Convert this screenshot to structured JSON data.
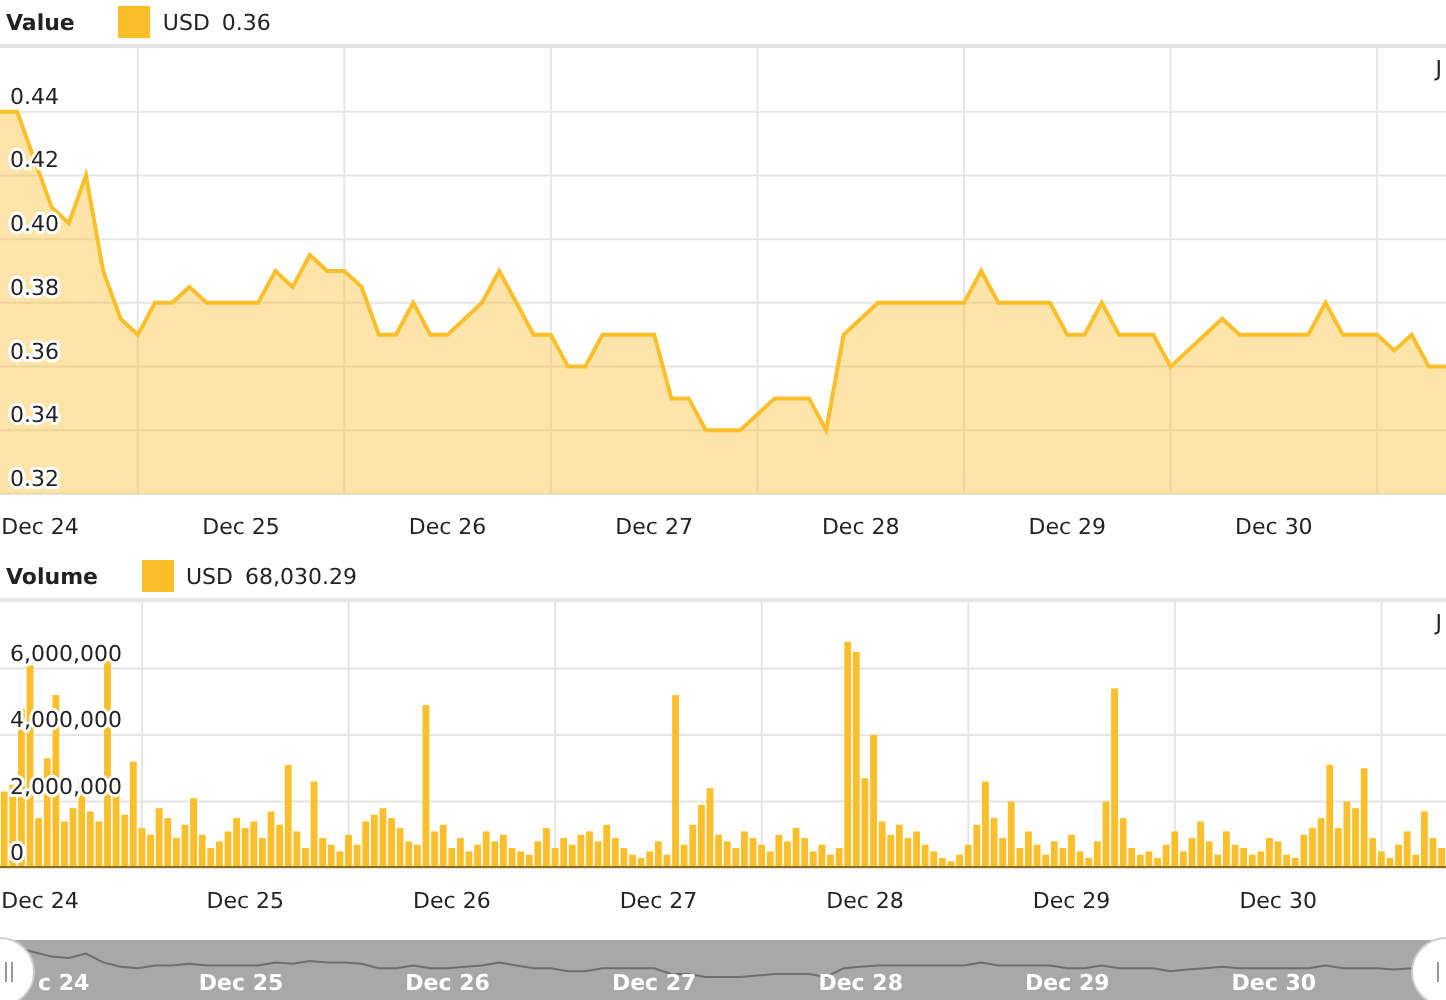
{
  "panels": [
    {
      "title": "Value",
      "legend": "0.36",
      "corner_label": "J",
      "chart_data": {
        "type": "area",
        "grid": true,
        "categories": [
          null,
          null,
          "Dec 24",
          null,
          null,
          null,
          null,
          null,
          null,
          null,
          null,
          null,
          null,
          null,
          "Dec 25",
          null,
          null,
          null,
          null,
          null,
          null,
          null,
          null,
          null,
          null,
          null,
          "Dec 26",
          null,
          null,
          null,
          null,
          null,
          null,
          null,
          null,
          null,
          null,
          null,
          "Dec 27",
          null,
          null,
          null,
          null,
          null,
          null,
          null,
          null,
          null,
          null,
          null,
          "Dec 28",
          null,
          null,
          null,
          null,
          null,
          null,
          null,
          null,
          null,
          null,
          null,
          "Dec 29",
          null,
          null,
          null,
          null,
          null,
          null,
          null,
          null,
          null,
          null,
          null,
          "Dec 30",
          null,
          null,
          null,
          null,
          null,
          null,
          null,
          null,
          null,
          null
        ],
        "series": [
          {
            "name": "USD",
            "color": "#fbbf2b",
            "values": [
              0.44,
              0.44,
              0.425,
              0.41,
              0.405,
              0.42,
              0.39,
              0.375,
              0.37,
              0.38,
              0.38,
              0.385,
              0.38,
              0.38,
              0.38,
              0.38,
              0.39,
              0.385,
              0.395,
              0.39,
              0.39,
              0.385,
              0.37,
              0.37,
              0.38,
              0.37,
              0.37,
              0.375,
              0.38,
              0.39,
              0.38,
              0.37,
              0.37,
              0.36,
              0.36,
              0.37,
              0.37,
              0.37,
              0.37,
              0.35,
              0.35,
              0.34,
              0.34,
              0.34,
              0.345,
              0.35,
              0.35,
              0.35,
              0.34,
              0.37,
              0.375,
              0.38,
              0.38,
              0.38,
              0.38,
              0.38,
              0.38,
              0.39,
              0.38,
              0.38,
              0.38,
              0.38,
              0.37,
              0.37,
              0.38,
              0.37,
              0.37,
              0.37,
              0.36,
              0.365,
              0.37,
              0.375,
              0.37,
              0.37,
              0.37,
              0.37,
              0.37,
              0.38,
              0.37,
              0.37,
              0.37,
              0.365,
              0.37,
              0.36,
              0.36
            ]
          }
        ],
        "ylim": [
          0.32,
          0.46
        ],
        "yticks": [
          {
            "value": 0.32,
            "label": "0.32"
          },
          {
            "value": 0.34,
            "label": "0.34"
          },
          {
            "value": 0.36,
            "label": "0.36"
          },
          {
            "value": 0.38,
            "label": "0.38"
          },
          {
            "value": 0.4,
            "label": "0.40"
          },
          {
            "value": 0.42,
            "label": "0.42"
          },
          {
            "value": 0.44,
            "label": "0.44"
          }
        ]
      }
    },
    {
      "title": "Volume",
      "legend": "68,030.29",
      "corner_label": "J",
      "chart_data": {
        "type": "bar",
        "grid": true,
        "categories": [
          null,
          null,
          null,
          null,
          "Dec 24",
          null,
          null,
          null,
          null,
          null,
          null,
          null,
          null,
          null,
          null,
          null,
          null,
          null,
          null,
          null,
          null,
          null,
          null,
          null,
          null,
          null,
          null,
          null,
          "Dec 25",
          null,
          null,
          null,
          null,
          null,
          null,
          null,
          null,
          null,
          null,
          null,
          null,
          null,
          null,
          null,
          null,
          null,
          null,
          null,
          null,
          null,
          null,
          null,
          "Dec 26",
          null,
          null,
          null,
          null,
          null,
          null,
          null,
          null,
          null,
          null,
          null,
          null,
          null,
          null,
          null,
          null,
          null,
          null,
          null,
          null,
          null,
          null,
          null,
          "Dec 27",
          null,
          null,
          null,
          null,
          null,
          null,
          null,
          null,
          null,
          null,
          null,
          null,
          null,
          null,
          null,
          null,
          null,
          null,
          null,
          null,
          null,
          null,
          null,
          "Dec 28",
          null,
          null,
          null,
          null,
          null,
          null,
          null,
          null,
          null,
          null,
          null,
          null,
          null,
          null,
          null,
          null,
          null,
          null,
          null,
          null,
          null,
          null,
          null,
          "Dec 29",
          null,
          null,
          null,
          null,
          null,
          null,
          null,
          null,
          null,
          null,
          null,
          null,
          null,
          null,
          null,
          null,
          null,
          null,
          null,
          null,
          null,
          null,
          null,
          "Dec 30",
          null,
          null,
          null,
          null,
          null,
          null,
          null,
          null,
          null,
          null,
          null,
          null,
          null,
          null,
          null,
          null,
          null,
          null,
          null
        ],
        "series": [
          {
            "name": "USD",
            "color": "#fbbf2b",
            "values": [
              2300000,
              2500000,
              4800000,
              6100000,
              1500000,
              3300000,
              5200000,
              1400000,
              1800000,
              2600000,
              1700000,
              1400000,
              6300000,
              2600000,
              1600000,
              3200000,
              1200000,
              1000000,
              1800000,
              1500000,
              900000,
              1300000,
              2100000,
              1000000,
              600000,
              800000,
              1100000,
              1500000,
              1200000,
              1400000,
              900000,
              1700000,
              1300000,
              3100000,
              1100000,
              600000,
              2600000,
              900000,
              700000,
              500000,
              1000000,
              700000,
              1400000,
              1600000,
              1800000,
              1500000,
              1200000,
              800000,
              700000,
              4900000,
              1100000,
              1300000,
              600000,
              900000,
              500000,
              700000,
              1100000,
              800000,
              1000000,
              600000,
              500000,
              400000,
              800000,
              1200000,
              600000,
              900000,
              700000,
              1000000,
              1100000,
              800000,
              1300000,
              900000,
              600000,
              400000,
              300000,
              500000,
              800000,
              400000,
              5200000,
              700000,
              1300000,
              1900000,
              2400000,
              1000000,
              800000,
              600000,
              1100000,
              900000,
              700000,
              500000,
              1000000,
              800000,
              1200000,
              900000,
              500000,
              700000,
              400000,
              600000,
              6800000,
              6500000,
              2700000,
              4000000,
              1400000,
              1000000,
              1300000,
              900000,
              1100000,
              700000,
              500000,
              300000,
              200000,
              400000,
              700000,
              1300000,
              2600000,
              1500000,
              900000,
              2000000,
              600000,
              1100000,
              700000,
              400000,
              800000,
              600000,
              1000000,
              500000,
              300000,
              800000,
              2000000,
              5400000,
              1500000,
              600000,
              400000,
              500000,
              300000,
              700000,
              1100000,
              500000,
              900000,
              1400000,
              800000,
              400000,
              1100000,
              700000,
              600000,
              400000,
              500000,
              900000,
              800000,
              400000,
              300000,
              1000000,
              1200000,
              1500000,
              3100000,
              1200000,
              2000000,
              1800000,
              3000000,
              900000,
              500000,
              300000,
              700000,
              1100000,
              400000,
              1700000,
              900000,
              600000
            ]
          }
        ],
        "ylim": [
          0,
          8000000
        ],
        "yticks": [
          {
            "value": 0,
            "label": "0"
          },
          {
            "value": 2000000,
            "label": "2,000,000"
          },
          {
            "value": 4000000,
            "label": "4,000,000"
          },
          {
            "value": 6000000,
            "label": "6,000,000"
          }
        ]
      }
    }
  ],
  "navigator": {
    "labels": [
      "c 24",
      "Dec 25",
      "Dec 26",
      "Dec 27",
      "Dec 28",
      "Dec 29",
      "Dec 30"
    ]
  }
}
